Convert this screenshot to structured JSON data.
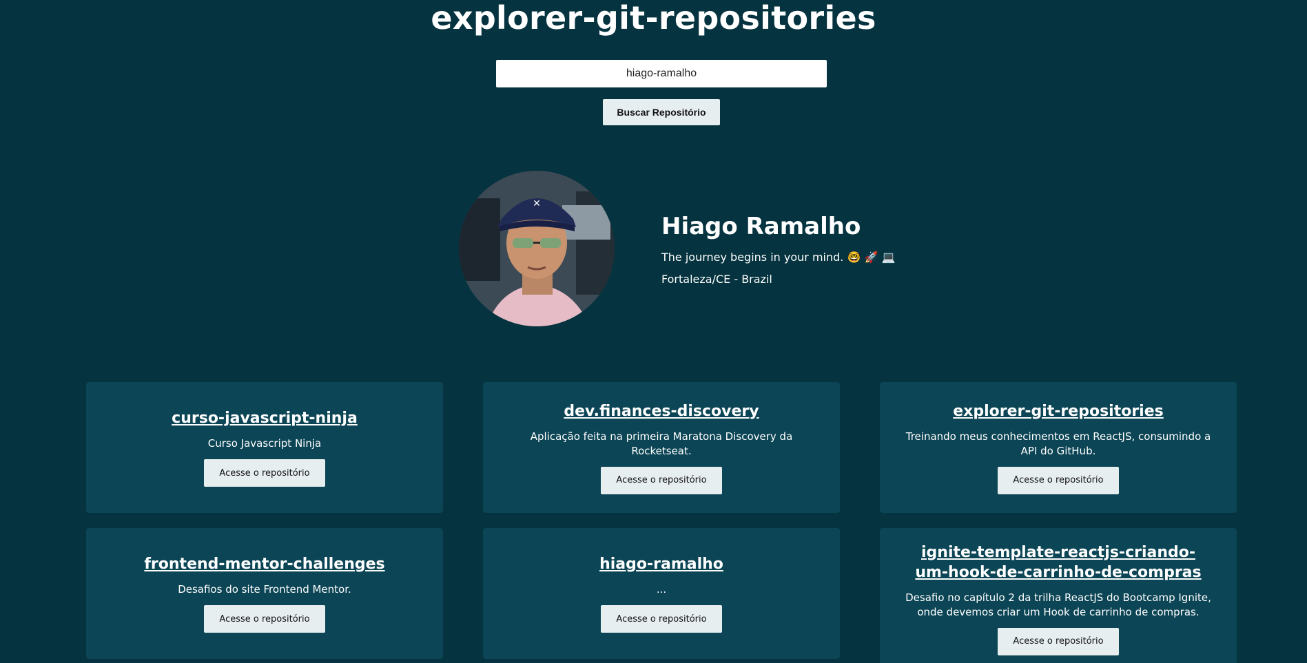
{
  "app": {
    "title": "explorer-git-repositories"
  },
  "search": {
    "value": "hiago-ramalho",
    "placeholder": "",
    "button_label": "Buscar Repositório"
  },
  "profile": {
    "name": "Hiago Ramalho",
    "bio": "The journey begins in your mind. 🤓 🚀 💻",
    "location": "Fortaleza/CE - Brazil"
  },
  "repos": [
    {
      "title": "curso-javascript-ninja",
      "description": "Curso Javascript Ninja",
      "button_label": "Acesse o repositório"
    },
    {
      "title": "dev.finances-discovery",
      "description": "Aplicação feita na primeira Maratona Discovery da Rocketseat.",
      "button_label": "Acesse o repositório"
    },
    {
      "title": "explorer-git-repositories",
      "description": "Treinando meus conhecimentos em ReactJS, consumindo a API do GitHub.",
      "button_label": "Acesse o repositório"
    },
    {
      "title": "frontend-mentor-challenges",
      "description": "Desafios do site Frontend Mentor.",
      "button_label": "Acesse o repositório"
    },
    {
      "title": "hiago-ramalho",
      "description": "...",
      "button_label": "Acesse o repositório"
    },
    {
      "title": "ignite-template-reactjs-criando-um-hook-de-carrinho-de-compras",
      "description": "Desafio no capítulo 2 da trilha ReactJS do Bootcamp Ignite, onde devemos criar um Hook de carrinho de compras.",
      "button_label": "Acesse o repositório"
    }
  ]
}
